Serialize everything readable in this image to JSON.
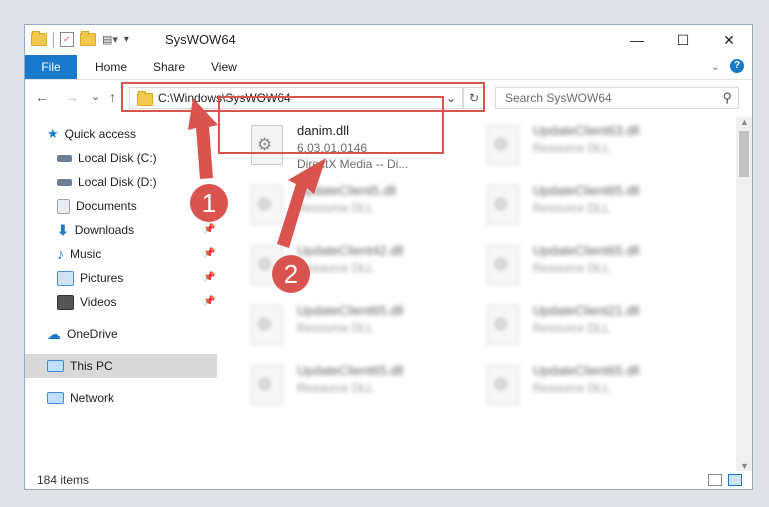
{
  "window": {
    "title": "SysWOW64",
    "minimize": "—",
    "maximize": "☐",
    "close": "✕"
  },
  "ribbon": {
    "file": "File",
    "tabs": [
      "Home",
      "Share",
      "View"
    ],
    "help": "?"
  },
  "address": {
    "path": "C:\\Windows\\SysWOW64",
    "dropdown": "⌄",
    "refresh": "↻"
  },
  "search": {
    "placeholder": "Search SysWOW64",
    "icon": "⚲"
  },
  "nav": {
    "back": "←",
    "forward": "→",
    "recent": "⌄",
    "up": "↑"
  },
  "sidebar": {
    "items": [
      {
        "label": "Quick access",
        "icon": "star-icon",
        "color": "#1979ca"
      },
      {
        "label": "Local Disk (C:)",
        "icon": "drive-icon",
        "color": "#6d7f92"
      },
      {
        "label": "Local Disk (D:)",
        "icon": "drive-icon",
        "color": "#6d7f92"
      },
      {
        "label": "Documents",
        "icon": "documents-icon",
        "color": "#9aa7b4"
      },
      {
        "label": "Downloads",
        "icon": "downloads-icon",
        "color": "#1979ca"
      },
      {
        "label": "Music",
        "icon": "music-icon",
        "color": "#1979ca"
      },
      {
        "label": "Pictures",
        "icon": "pictures-icon",
        "color": "#4a8fd1"
      },
      {
        "label": "Videos",
        "icon": "videos-icon",
        "color": "#555"
      },
      {
        "label": "OneDrive",
        "icon": "cloud-icon",
        "color": "#1979ca"
      },
      {
        "label": "This PC",
        "icon": "monitor-icon",
        "color": "#3c8ad8"
      },
      {
        "label": "Network",
        "icon": "network-icon",
        "color": "#3c8ad8"
      }
    ]
  },
  "files": [
    {
      "name": "danim.dll",
      "meta1": "6.03.01.0146",
      "meta2": "DirectX Media -- Di..."
    },
    {
      "name": "UpdateClient63.dll",
      "meta1": "Resource DLL"
    },
    {
      "name": "UpdateClient5.dll",
      "meta1": "Resource DLL"
    },
    {
      "name": "UpdateClient65.dll",
      "meta1": "Resource DLL"
    },
    {
      "name": "UpdateClient42.dll",
      "meta1": "Resource DLL"
    },
    {
      "name": "UpdateClient65.dll",
      "meta1": "Resource DLL"
    },
    {
      "name": "UpdateClient65.dll",
      "meta1": "Resource DLL"
    },
    {
      "name": "UpdateClient21.dll",
      "meta1": "Resource DLL"
    },
    {
      "name": "UpdateClient65.dll",
      "meta1": "Resource DLL"
    },
    {
      "name": "UpdateClient65.dll",
      "meta1": "Resource DLL"
    }
  ],
  "status": {
    "count": "184 items"
  },
  "annotations": {
    "step1": "1",
    "step2": "2",
    "color": "#d9534f"
  }
}
